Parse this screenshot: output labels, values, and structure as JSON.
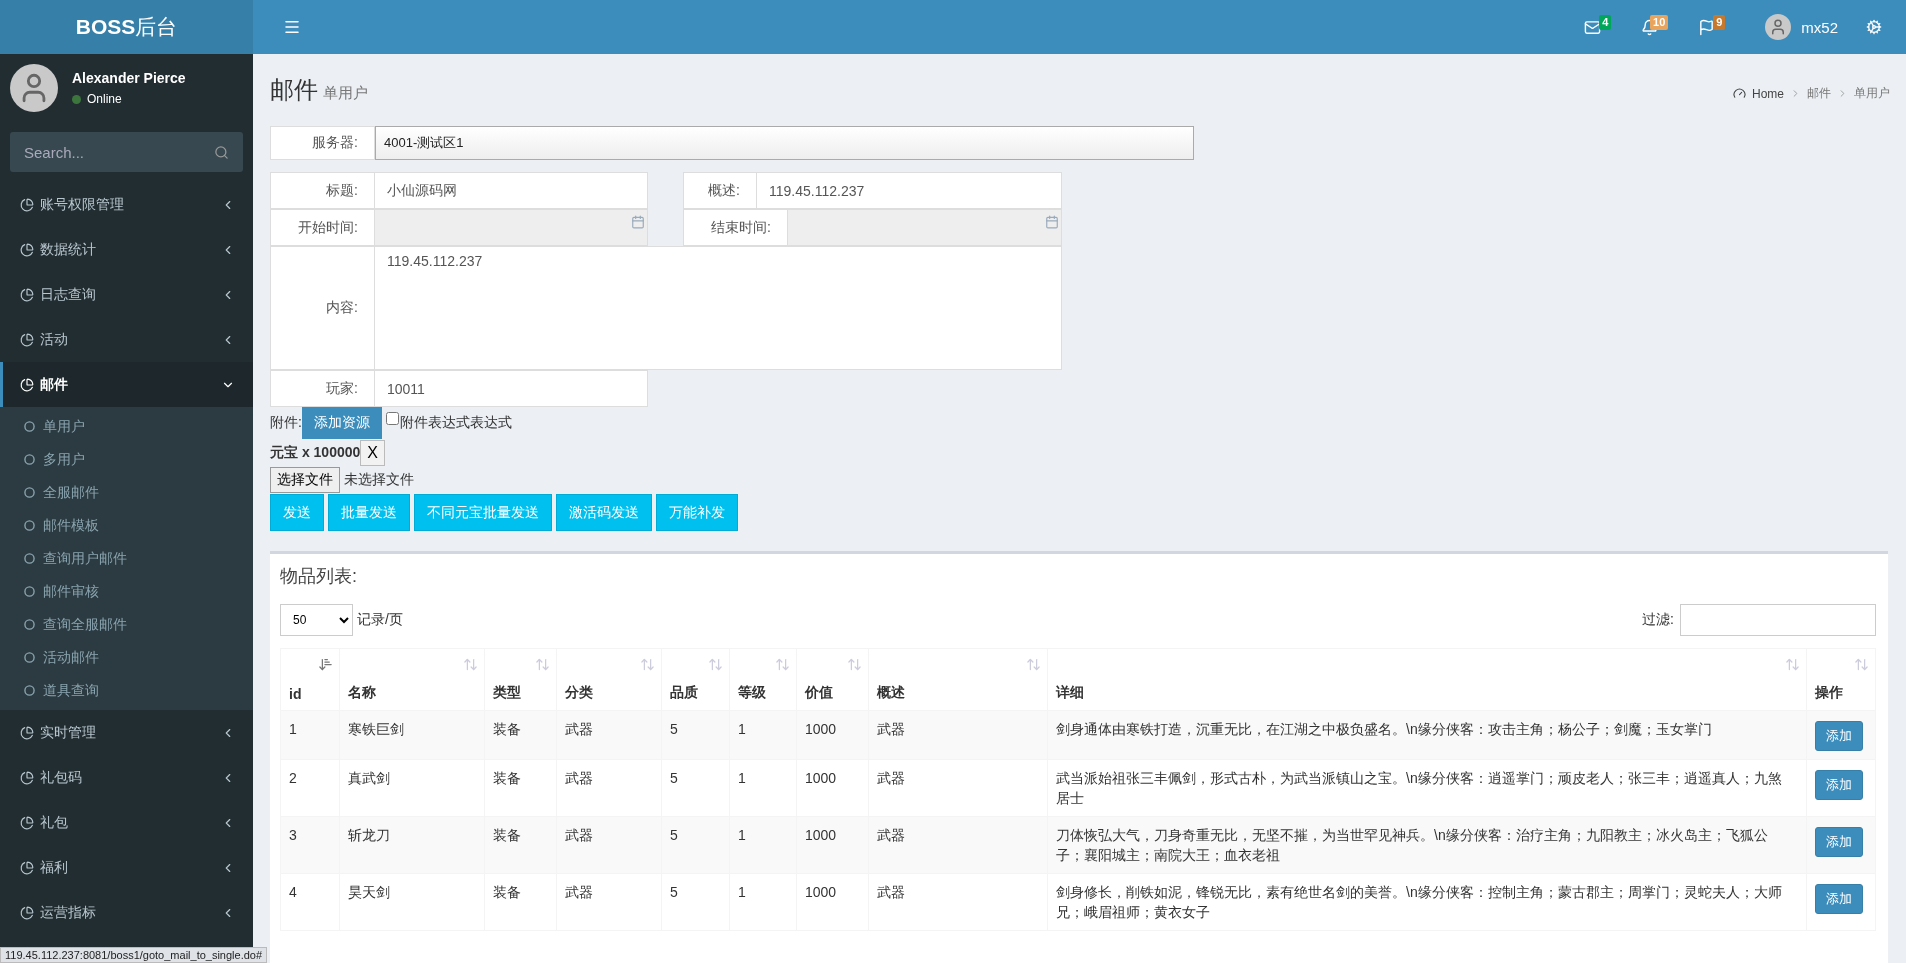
{
  "logo": "**BOSS**后台",
  "header": {
    "notifications": [
      {
        "kind": "mail",
        "count": "4",
        "color": "#00a65a"
      },
      {
        "kind": "bell",
        "count": "10",
        "color": "#e8a35c"
      },
      {
        "kind": "flag",
        "count": "9",
        "color": "#c6792c"
      }
    ],
    "user": "mx52"
  },
  "sidebar": {
    "user": {
      "name": "Alexander Pierce",
      "status": "Online"
    },
    "search": {
      "placeholder": "Search..."
    },
    "items": [
      {
        "label": "账号权限管理",
        "expanded": false,
        "selected": false
      },
      {
        "label": "数据统计",
        "expanded": false,
        "selected": false
      },
      {
        "label": "日志查询",
        "expanded": false,
        "selected": false
      },
      {
        "label": "活动",
        "expanded": false,
        "selected": false
      },
      {
        "label": "邮件",
        "expanded": true,
        "selected": true,
        "children": [
          {
            "label": "单用户"
          },
          {
            "label": "多用户"
          },
          {
            "label": "全服邮件"
          },
          {
            "label": "邮件模板"
          },
          {
            "label": "查询用户邮件"
          },
          {
            "label": "邮件审核"
          },
          {
            "label": "查询全服邮件"
          },
          {
            "label": "活动邮件"
          },
          {
            "label": "道具查询"
          }
        ]
      },
      {
        "label": "实时管理",
        "expanded": false,
        "selected": false
      },
      {
        "label": "礼包码",
        "expanded": false,
        "selected": false
      },
      {
        "label": "礼包",
        "expanded": false,
        "selected": false
      },
      {
        "label": "福利",
        "expanded": false,
        "selected": false
      },
      {
        "label": "运营指标",
        "expanded": false,
        "selected": false
      }
    ]
  },
  "page": {
    "title": "邮件",
    "subtitle": "单用户",
    "breadcrumb": [
      "Home",
      "邮件",
      "单用户"
    ]
  },
  "form": {
    "server": {
      "label": "服务器:",
      "value": "4001-测试区1"
    },
    "title": {
      "label": "标题:",
      "value": "小仙源码网"
    },
    "summary": {
      "label": "概述:",
      "value": "119.45.112.237"
    },
    "start_time": {
      "label": "开始时间:"
    },
    "end_time": {
      "label": "结束时间:"
    },
    "content": {
      "label": "内容:",
      "value": "119.45.112.237"
    },
    "player": {
      "label": "玩家:",
      "value": "10011"
    },
    "attachment": {
      "label": "附件:",
      "button": "添加资源",
      "checkbox": {
        "label": "附件表达式表达式",
        "checked": false
      }
    },
    "attached_item": {
      "text": "元宝 x 100000",
      "remove": "X"
    },
    "file": {
      "button": "选择文件",
      "status": "未选择文件"
    },
    "actions": [
      "发送",
      "批量发送",
      "不同元宝批量发送",
      "激活码发送",
      "万能补发"
    ]
  },
  "item_list": {
    "title": "物品列表:",
    "page_size": "50",
    "page_size_label": "记录/页",
    "filter_label": "过滤:",
    "columns": [
      {
        "label": "id",
        "sorted": true
      },
      {
        "label": "名称",
        "sorted": false
      },
      {
        "label": "类型",
        "sorted": false
      },
      {
        "label": "分类",
        "sorted": false
      },
      {
        "label": "品质",
        "sorted": false
      },
      {
        "label": "等级",
        "sorted": false
      },
      {
        "label": "价值",
        "sorted": false
      },
      {
        "label": "概述",
        "sorted": false
      },
      {
        "label": "详细",
        "sorted": false
      },
      {
        "label": "操作",
        "sorted": false
      }
    ],
    "rows": [
      {
        "cells": [
          "1",
          "寒铁巨剑",
          "装备",
          "武器",
          "5",
          "1",
          "1000",
          "武器",
          "剑身通体由寒铁打造，沉重无比，在江湖之中极负盛名。\\n缘分侠客：攻击主角；杨公子；剑魔；玉女掌门"
        ],
        "action": "添加"
      },
      {
        "cells": [
          "2",
          "真武剑",
          "装备",
          "武器",
          "5",
          "1",
          "1000",
          "武器",
          "武当派始祖张三丰佩剑，形式古朴，为武当派镇山之宝。\\n缘分侠客：逍遥掌门；顽皮老人；张三丰；逍遥真人；九煞居士"
        ],
        "action": "添加"
      },
      {
        "cells": [
          "3",
          "斩龙刀",
          "装备",
          "武器",
          "5",
          "1",
          "1000",
          "武器",
          "刀体恢弘大气，刀身奇重无比，无坚不摧，为当世罕见神兵。\\n缘分侠客：治疗主角；九阳教主；冰火岛主；飞狐公子；襄阳城主；南院大王；血衣老祖"
        ],
        "action": "添加"
      },
      {
        "cells": [
          "4",
          "昊天剑",
          "装备",
          "武器",
          "5",
          "1",
          "1000",
          "武器",
          "剑身修长，削铁如泥，锋锐无比，素有绝世名剑的美誉。\\n缘分侠客：控制主角；蒙古郡主；周掌门；灵蛇夫人；大师兄；峨眉祖师；黄衣女子"
        ],
        "action": "添加"
      }
    ]
  },
  "status_bar": "119.45.112.237:8081/boss1/goto_mail_to_single.do#"
}
